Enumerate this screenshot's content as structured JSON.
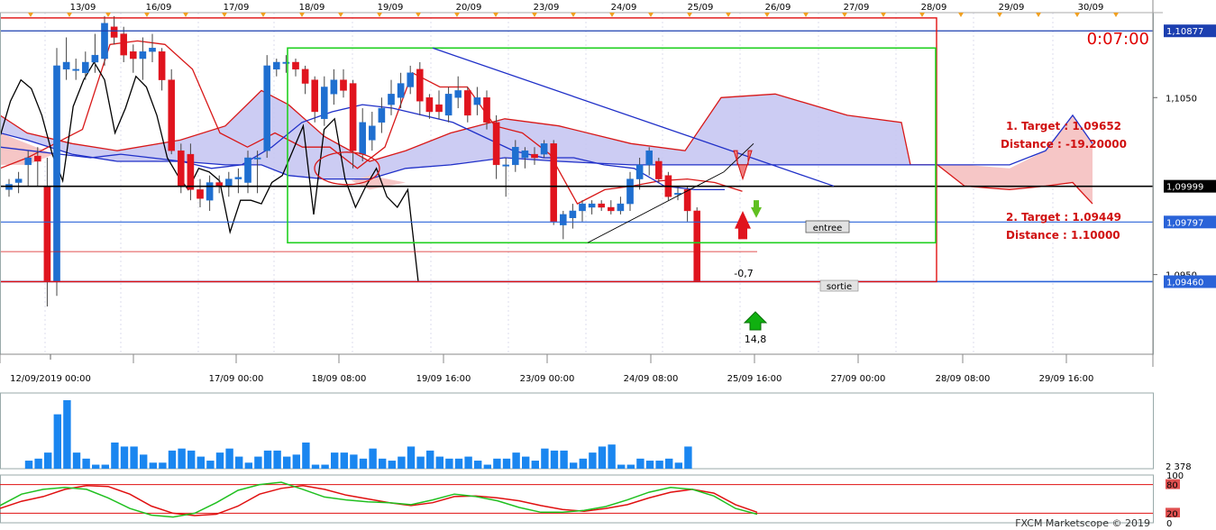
{
  "chart_data": [
    {
      "type": "candlestick",
      "instrument_note": "",
      "top_dates": [
        "13/09",
        "16/09",
        "17/09",
        "18/09",
        "19/09",
        "20/09",
        "23/09",
        "24/09",
        "25/09",
        "26/09",
        "27/09",
        "28/09",
        "29/09",
        "30/09"
      ],
      "x_tick_labels": [
        "12/09/2019 00:00",
        "17/09 00:00",
        "18/09 08:00",
        "19/09 16:00",
        "23/09 00:00",
        "24/09 08:00",
        "25/09 16:00",
        "27/09 00:00",
        "28/09 08:00",
        "29/09 16:00"
      ],
      "y_tick_labels": [
        "1,1050",
        "1,0950"
      ],
      "price_tags": [
        {
          "label": "1,10877",
          "value": 1.10877,
          "bg": "#1c3fb0",
          "fg": "#ffffff"
        },
        {
          "label": "1,09999",
          "value": 1.09999,
          "bg": "#000000",
          "fg": "#ffffff"
        },
        {
          "label": "1,09797",
          "value": 1.09797,
          "bg": "#2a63d8",
          "fg": "#ffffff"
        },
        {
          "label": "1,09460",
          "value": 1.0946,
          "bg": "#2a63d8",
          "fg": "#ffffff"
        }
      ],
      "ylim": [
        1.0905,
        1.1098
      ],
      "timer": "0:07:00",
      "annotations": {
        "target1": "1. Target : 1.09652",
        "distance1": "Distance : -19.20000",
        "target2": "2. Target : 1.09449",
        "distance2": "Distance : 1.10000",
        "entree": "entree",
        "sortie": "sortie",
        "signal_down_value": "-0,7",
        "signal_up_value": "14,8"
      },
      "candles": [
        {
          "o": 1.0998,
          "h": 1.1004,
          "l": 1.0994,
          "c": 1.1001
        },
        {
          "o": 1.1002,
          "h": 1.1008,
          "l": 1.0996,
          "c": 1.1004
        },
        {
          "o": 1.1012,
          "h": 1.102,
          "l": 1.1,
          "c": 1.1016
        },
        {
          "o": 1.1017,
          "h": 1.1022,
          "l": 1.1,
          "c": 1.1014
        },
        {
          "o": 1.1,
          "h": 1.1016,
          "l": 1.0932,
          "c": 1.0946
        },
        {
          "o": 1.0946,
          "h": 1.1078,
          "l": 1.0938,
          "c": 1.1068
        },
        {
          "o": 1.1066,
          "h": 1.1084,
          "l": 1.106,
          "c": 1.107
        },
        {
          "o": 1.1066,
          "h": 1.1072,
          "l": 1.106,
          "c": 1.1066
        },
        {
          "o": 1.1064,
          "h": 1.1076,
          "l": 1.106,
          "c": 1.107
        },
        {
          "o": 1.107,
          "h": 1.1086,
          "l": 1.1064,
          "c": 1.1074
        },
        {
          "o": 1.1072,
          "h": 1.1096,
          "l": 1.1068,
          "c": 1.1092
        },
        {
          "o": 1.109,
          "h": 1.1096,
          "l": 1.108,
          "c": 1.1084
        },
        {
          "o": 1.1086,
          "h": 1.109,
          "l": 1.107,
          "c": 1.1074
        },
        {
          "o": 1.1076,
          "h": 1.108,
          "l": 1.1064,
          "c": 1.1072
        },
        {
          "o": 1.1072,
          "h": 1.1084,
          "l": 1.106,
          "c": 1.1076
        },
        {
          "o": 1.1076,
          "h": 1.1086,
          "l": 1.107,
          "c": 1.1078
        },
        {
          "o": 1.1076,
          "h": 1.1078,
          "l": 1.1054,
          "c": 1.106
        },
        {
          "o": 1.106,
          "h": 1.1066,
          "l": 1.1018,
          "c": 1.102
        },
        {
          "o": 1.102,
          "h": 1.1024,
          "l": 1.0996,
          "c": 1.1
        },
        {
          "o": 1.1018,
          "h": 1.1024,
          "l": 1.0992,
          "c": 1.0998
        },
        {
          "o": 1.0998,
          "h": 1.1004,
          "l": 1.0988,
          "c": 1.0993
        },
        {
          "o": 1.0992,
          "h": 1.1006,
          "l": 1.0986,
          "c": 1.1002
        },
        {
          "o": 1.1002,
          "h": 1.1006,
          "l": 1.0996,
          "c": 1.1
        },
        {
          "o": 1.1,
          "h": 1.1008,
          "l": 1.0994,
          "c": 1.1004
        },
        {
          "o": 1.1004,
          "h": 1.101,
          "l": 1.0996,
          "c": 1.1005
        },
        {
          "o": 1.1002,
          "h": 1.102,
          "l": 1.0996,
          "c": 1.1016
        },
        {
          "o": 1.1016,
          "h": 1.102,
          "l": 1.0996,
          "c": 1.1016
        },
        {
          "o": 1.102,
          "h": 1.1074,
          "l": 1.1016,
          "c": 1.1068
        },
        {
          "o": 1.1066,
          "h": 1.1072,
          "l": 1.1062,
          "c": 1.107
        },
        {
          "o": 1.107,
          "h": 1.1074,
          "l": 1.1064,
          "c": 1.107
        },
        {
          "o": 1.107,
          "h": 1.1072,
          "l": 1.1062,
          "c": 1.1066
        },
        {
          "o": 1.1066,
          "h": 1.1068,
          "l": 1.1052,
          "c": 1.1058
        },
        {
          "o": 1.106,
          "h": 1.1062,
          "l": 1.1036,
          "c": 1.1042
        },
        {
          "o": 1.1038,
          "h": 1.1062,
          "l": 1.1034,
          "c": 1.1056
        },
        {
          "o": 1.1052,
          "h": 1.1066,
          "l": 1.1046,
          "c": 1.106
        },
        {
          "o": 1.106,
          "h": 1.1066,
          "l": 1.105,
          "c": 1.1054
        },
        {
          "o": 1.1058,
          "h": 1.106,
          "l": 1.101,
          "c": 1.102
        },
        {
          "o": 1.1018,
          "h": 1.1044,
          "l": 1.1014,
          "c": 1.1036
        },
        {
          "o": 1.1026,
          "h": 1.1042,
          "l": 1.102,
          "c": 1.1034
        },
        {
          "o": 1.1036,
          "h": 1.105,
          "l": 1.103,
          "c": 1.1044
        },
        {
          "o": 1.1046,
          "h": 1.106,
          "l": 1.104,
          "c": 1.1052
        },
        {
          "o": 1.105,
          "h": 1.1064,
          "l": 1.1044,
          "c": 1.1058
        },
        {
          "o": 1.1056,
          "h": 1.1068,
          "l": 1.1052,
          "c": 1.1064
        },
        {
          "o": 1.1066,
          "h": 1.107,
          "l": 1.104,
          "c": 1.1048
        },
        {
          "o": 1.105,
          "h": 1.1052,
          "l": 1.1038,
          "c": 1.1042
        },
        {
          "o": 1.1046,
          "h": 1.1054,
          "l": 1.1038,
          "c": 1.1042
        },
        {
          "o": 1.104,
          "h": 1.1056,
          "l": 1.1036,
          "c": 1.1052
        },
        {
          "o": 1.105,
          "h": 1.1062,
          "l": 1.1044,
          "c": 1.1054
        },
        {
          "o": 1.1054,
          "h": 1.1056,
          "l": 1.1036,
          "c": 1.104
        },
        {
          "o": 1.1046,
          "h": 1.1056,
          "l": 1.104,
          "c": 1.105
        },
        {
          "o": 1.105,
          "h": 1.1054,
          "l": 1.1032,
          "c": 1.1036
        },
        {
          "o": 1.1036,
          "h": 1.104,
          "l": 1.1004,
          "c": 1.1012
        },
        {
          "o": 1.1012,
          "h": 1.1016,
          "l": 1.0994,
          "c": 1.1012
        },
        {
          "o": 1.1012,
          "h": 1.1026,
          "l": 1.1008,
          "c": 1.1022
        },
        {
          "o": 1.1016,
          "h": 1.1022,
          "l": 1.101,
          "c": 1.102
        },
        {
          "o": 1.1018,
          "h": 1.1022,
          "l": 1.1012,
          "c": 1.1016
        },
        {
          "o": 1.1018,
          "h": 1.1026,
          "l": 1.1016,
          "c": 1.1024
        },
        {
          "o": 1.1024,
          "h": 1.1026,
          "l": 1.0978,
          "c": 1.098
        },
        {
          "o": 1.0978,
          "h": 1.0986,
          "l": 1.097,
          "c": 1.0984
        },
        {
          "o": 1.0982,
          "h": 1.099,
          "l": 1.0976,
          "c": 1.0986
        },
        {
          "o": 1.0986,
          "h": 1.0992,
          "l": 1.098,
          "c": 1.099
        },
        {
          "o": 1.0988,
          "h": 1.0992,
          "l": 1.0984,
          "c": 1.099
        },
        {
          "o": 1.099,
          "h": 1.0992,
          "l": 1.0986,
          "c": 1.0988
        },
        {
          "o": 1.0988,
          "h": 1.0992,
          "l": 1.0984,
          "c": 1.0986
        },
        {
          "o": 1.0986,
          "h": 1.0994,
          "l": 1.0984,
          "c": 1.099
        },
        {
          "o": 1.099,
          "h": 1.1008,
          "l": 1.0986,
          "c": 1.1004
        },
        {
          "o": 1.1004,
          "h": 1.1016,
          "l": 1.0998,
          "c": 1.1012
        },
        {
          "o": 1.1012,
          "h": 1.1022,
          "l": 1.1006,
          "c": 1.102
        },
        {
          "o": 1.1014,
          "h": 1.1016,
          "l": 1.1002,
          "c": 1.1004
        },
        {
          "o": 1.1006,
          "h": 1.1008,
          "l": 1.0992,
          "c": 1.0994
        },
        {
          "o": 1.0996,
          "h": 1.1,
          "l": 1.0992,
          "c": 1.0996
        },
        {
          "o": 1.0998,
          "h": 1.1,
          "l": 1.098,
          "c": 1.0986
        },
        {
          "o": 1.0986,
          "h": 1.0988,
          "l": 1.0946,
          "c": 1.0946
        }
      ],
      "lines": {
        "black": [
          1.1028,
          1.1048,
          1.106,
          1.1055,
          1.104,
          1.1018,
          1.1003,
          1.1045,
          1.106,
          1.107,
          1.106,
          1.103,
          1.1044,
          1.1062,
          1.1056,
          1.104,
          1.1016,
          1.1006,
          1.0998,
          1.101,
          1.1008,
          1.1003,
          1.0974,
          1.0992,
          1.0992,
          1.099,
          1.1002,
          1.1006,
          1.102,
          1.1034,
          1.0984,
          1.1032,
          1.1038,
          1.1004,
          1.0988,
          1.1,
          1.101,
          1.0994,
          1.0988,
          1.0998,
          1.0946
        ],
        "black_last_index": 19,
        "kijun": [
          1.101,
          1.1016,
          1.1024,
          1.1032,
          1.108,
          1.1082,
          1.108,
          1.1066,
          1.103,
          1.1022,
          1.103,
          1.1022,
          1.1022,
          1.101,
          1.1022,
          1.1064,
          1.1056,
          1.1056,
          1.1034,
          1.103,
          1.1018,
          1.099,
          1.0998,
          1.1,
          1.1003,
          1.1004,
          1.1002,
          1.0997
        ],
        "tenkan": [
          1.1022,
          1.102,
          1.1018,
          1.1016,
          1.1018,
          1.1016,
          1.1014,
          1.101,
          1.1012,
          1.1022,
          1.1036,
          1.1042,
          1.1046,
          1.1044,
          1.104,
          1.1036,
          1.1028,
          1.102,
          1.1016,
          1.1016,
          1.1012,
          1.101,
          1.1,
          1.0998,
          1.0998
        ]
      },
      "volume": [
        4,
        5,
        8,
        27,
        34,
        8,
        5,
        2,
        2,
        13,
        11,
        11,
        7,
        3,
        3,
        9,
        10,
        9,
        6,
        4,
        8,
        10,
        6,
        3,
        6,
        9,
        9,
        6,
        7,
        13,
        2,
        2,
        8,
        8,
        7,
        5,
        10,
        5,
        4,
        6,
        11,
        6,
        9,
        6,
        5,
        5,
        6,
        4,
        2,
        5,
        5,
        8,
        6,
        4,
        10,
        9,
        9,
        3,
        5,
        8,
        11,
        12,
        2,
        2,
        5,
        4,
        4,
        5,
        3,
        11
      ],
      "volume_label": "2 378",
      "oscillator": {
        "levels": [
          "100",
          "80",
          "20",
          "0"
        ],
        "red": [
          30,
          45,
          55,
          70,
          78,
          76,
          60,
          35,
          20,
          15,
          18,
          35,
          60,
          72,
          78,
          70,
          58,
          50,
          42,
          36,
          42,
          55,
          56,
          52,
          46,
          36,
          28,
          24,
          30,
          38,
          52,
          64,
          70,
          62,
          38,
          22
        ],
        "green": [
          36,
          60,
          70,
          74,
          70,
          52,
          30,
          16,
          12,
          20,
          42,
          68,
          80,
          85,
          70,
          54,
          48,
          44,
          42,
          38,
          48,
          60,
          55,
          46,
          32,
          22,
          22,
          26,
          34,
          48,
          64,
          74,
          70,
          56,
          30,
          18
        ]
      },
      "footer": "FXCM Marketscope © 2019"
    }
  ]
}
